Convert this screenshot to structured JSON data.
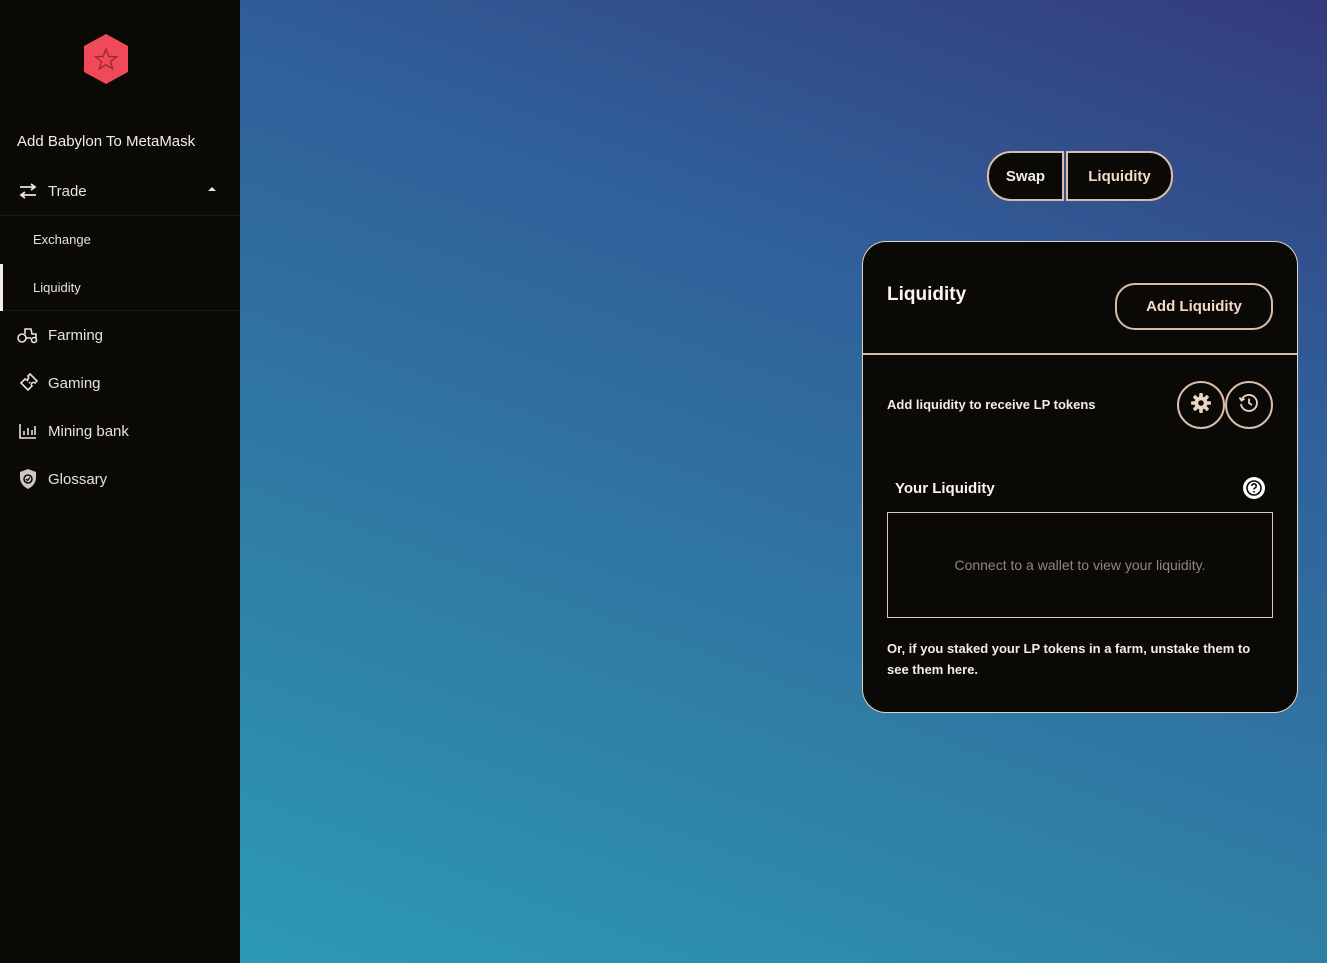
{
  "sidebar": {
    "metamask_link": "Add Babylon To MetaMask",
    "trade": {
      "label": "Trade",
      "icon": "swap-arrows-icon"
    },
    "sub_items": [
      {
        "label": "Exchange",
        "active": false
      },
      {
        "label": "Liquidity",
        "active": true
      }
    ],
    "items": [
      {
        "label": "Farming",
        "icon": "tractor-icon"
      },
      {
        "label": "Gaming",
        "icon": "ticket-icon"
      },
      {
        "label": "Mining bank",
        "icon": "bar-chart-icon"
      },
      {
        "label": "Glossary",
        "icon": "shield-icon"
      }
    ]
  },
  "tabs": {
    "swap": "Swap",
    "liquidity": "Liquidity"
  },
  "card": {
    "title": "Liquidity",
    "add_button": "Add Liquidity",
    "subtitle": "Add liquidity to receive LP tokens",
    "your_liquidity": "Your Liquidity",
    "empty_message": "Connect to a wallet to view your liquidity.",
    "note": "Or, if you staked your LP tokens in a farm, unstake them to see them here."
  },
  "colors": {
    "accent_border": "#d9bca9",
    "logo": "#f04a5a",
    "panel_bg": "#0b0906"
  }
}
